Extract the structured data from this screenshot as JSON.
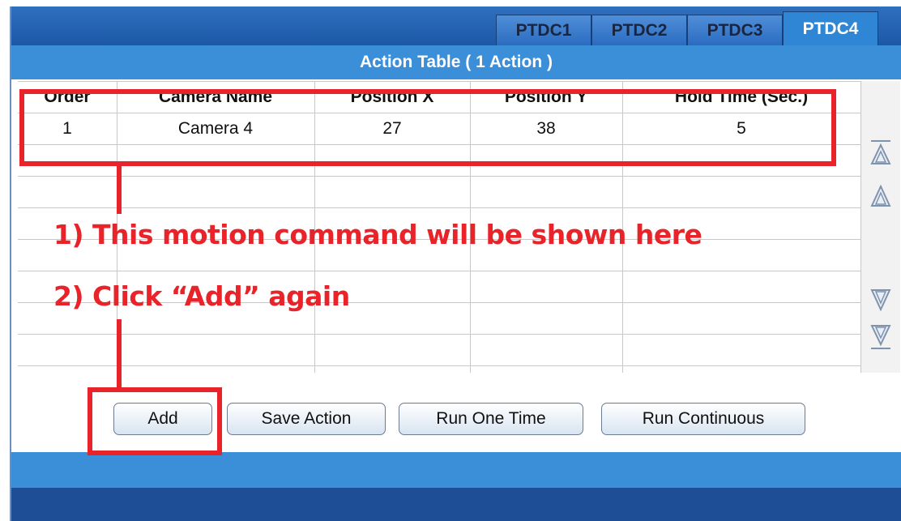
{
  "tabs": [
    {
      "label": "PTDC1",
      "active": false
    },
    {
      "label": "PTDC2",
      "active": false
    },
    {
      "label": "PTDC3",
      "active": false
    },
    {
      "label": "PTDC4",
      "active": true
    }
  ],
  "title": "Action Table  ( 1 Action )",
  "table": {
    "columns": [
      "Order",
      "Camera Name",
      "Position X",
      "Position Y",
      "Hold Time (Sec.)"
    ],
    "rows": [
      [
        "1",
        "Camera 4",
        "27",
        "38",
        "5"
      ]
    ]
  },
  "scroll_icons": [
    "scroll-top-icon",
    "scroll-up-icon",
    "scroll-down-icon",
    "scroll-bottom-icon"
  ],
  "buttons": {
    "add": "Add",
    "save_action": "Save Action",
    "run_one_time": "Run One Time",
    "run_continuous": "Run Continuous"
  },
  "annotations": {
    "step1": "1) This motion command will be shown here",
    "step2": "2) Click “Add” again"
  },
  "colors": {
    "accent": "#2f86d4",
    "annotation": "#e8232a"
  }
}
